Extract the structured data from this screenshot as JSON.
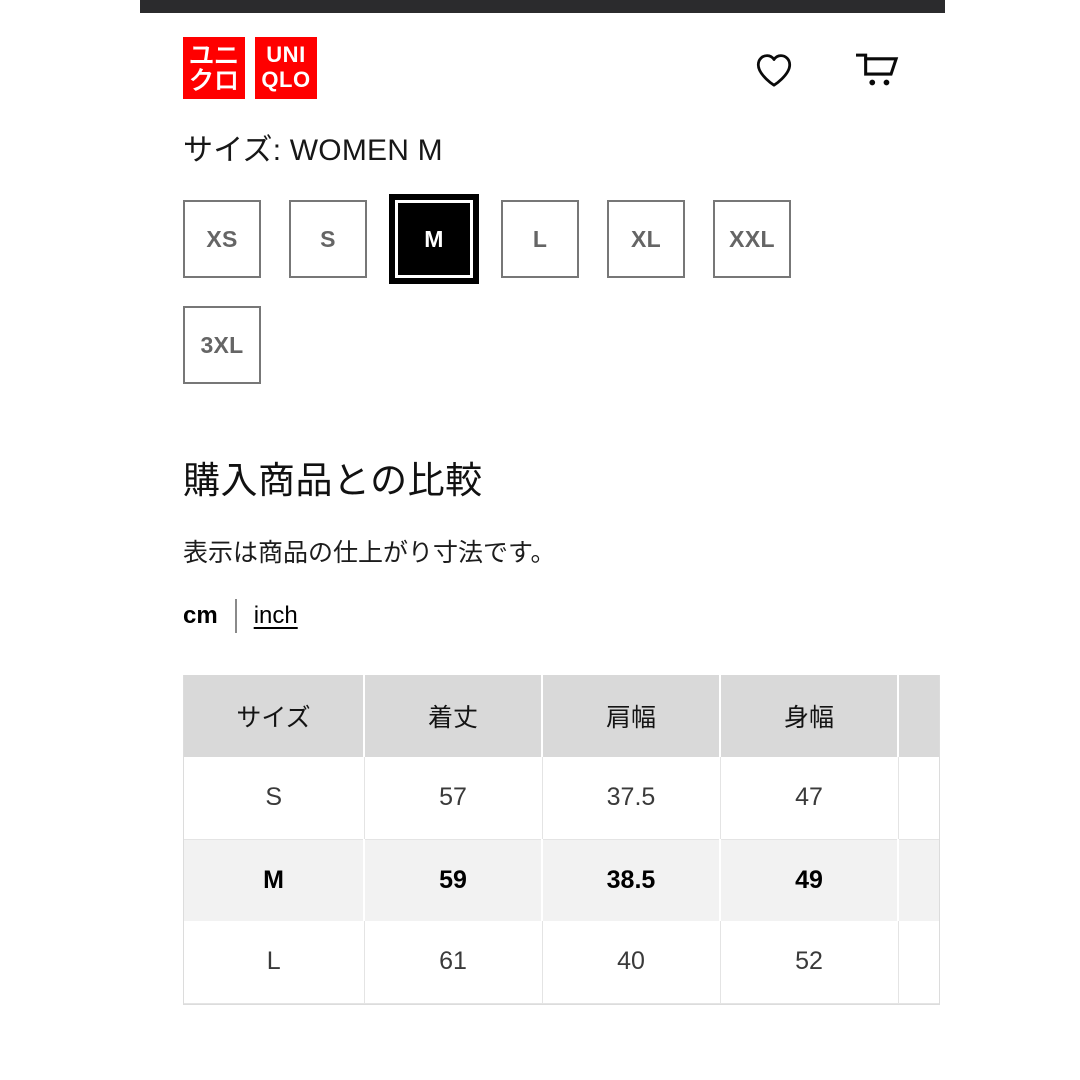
{
  "header": {
    "logo": {
      "jp_line1": "ユニ",
      "jp_line2": "クロ",
      "en_line1": "UNI",
      "en_line2": "QLO",
      "color": "#ff0000"
    },
    "actions": [
      {
        "name": "wishlist",
        "icon": "heart-icon"
      },
      {
        "name": "cart",
        "icon": "cart-icon"
      }
    ]
  },
  "size_selector": {
    "label": "サイズ: WOMEN M",
    "selected": "M",
    "options": [
      {
        "label": "XS",
        "selected": false
      },
      {
        "label": "S",
        "selected": false
      },
      {
        "label": "M",
        "selected": true
      },
      {
        "label": "L",
        "selected": false
      },
      {
        "label": "XL",
        "selected": false
      },
      {
        "label": "XXL",
        "selected": false
      },
      {
        "label": "3XL",
        "selected": false
      }
    ]
  },
  "comparison": {
    "heading": "購入商品との比較",
    "note": "表示は商品の仕上がり寸法です。",
    "units": {
      "active": "cm",
      "alternate": "inch"
    }
  },
  "chart_data": {
    "type": "table",
    "title": "購入商品との比較",
    "columns": [
      "サイズ",
      "着丈",
      "肩幅",
      "身幅",
      ""
    ],
    "rows": [
      {
        "cells": [
          "S",
          "57",
          "37.5",
          "47",
          ""
        ],
        "highlight": false
      },
      {
        "cells": [
          "M",
          "59",
          "38.5",
          "49",
          ""
        ],
        "highlight": true
      },
      {
        "cells": [
          "L",
          "61",
          "40",
          "52",
          ""
        ],
        "highlight": false
      }
    ],
    "unit": "cm",
    "note": "表示は商品の仕上がり寸法です。",
    "header_background": "#d9d9d9",
    "highlight_background": "#f2f2f2"
  }
}
